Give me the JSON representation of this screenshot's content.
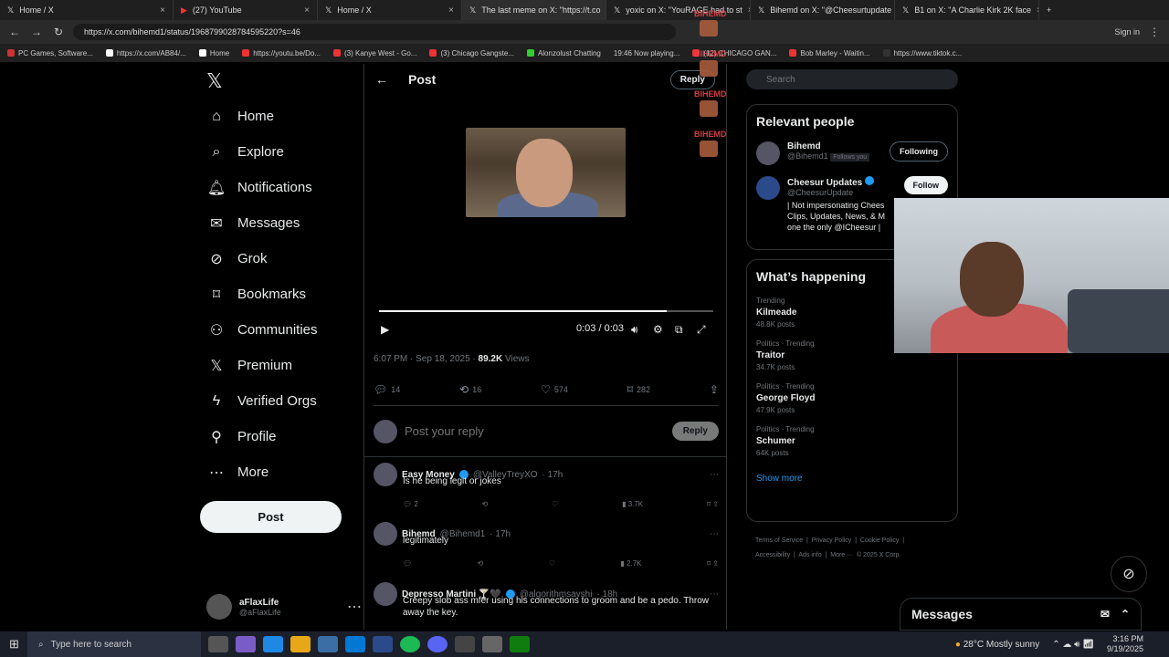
{
  "tabs": [
    {
      "label": "Home / X"
    },
    {
      "label": "(27) YouTube"
    },
    {
      "label": "Home / X"
    },
    {
      "label": "The last meme on X: \"https://t.co"
    },
    {
      "label": "yoxic on X: \"YouRAGE had to st"
    },
    {
      "label": "Bihemd on X: \"@Cheesurtupdate"
    },
    {
      "label": "B1 on X: \"A Charlie Kirk 2K face"
    }
  ],
  "address": {
    "url": "https://x.com/bihemd1/status/1968799028784595220?s=46",
    "signin": "Sign in"
  },
  "bookmarks": [
    {
      "label": "PC Games, Software..."
    },
    {
      "label": "https://x.com/AB84/..."
    },
    {
      "label": "Home"
    },
    {
      "label": "https://youtu.be/Do..."
    },
    {
      "label": "(3) Kanye West - Go..."
    },
    {
      "label": "(3) Chicago Gangste..."
    },
    {
      "label": "Alonzolust Chatting"
    },
    {
      "label": "19:46 Now playing..."
    },
    {
      "label": "(12) CHICAGO GAN..."
    },
    {
      "label": "Bob Marley - Waitin..."
    },
    {
      "label": "https://www.tiktok.c..."
    }
  ],
  "nav": {
    "items": [
      {
        "label": "Home",
        "icon": "home-icon"
      },
      {
        "label": "Explore",
        "icon": "search-icon"
      },
      {
        "label": "Notifications",
        "icon": "bell-icon"
      },
      {
        "label": "Messages",
        "icon": "mail-icon"
      },
      {
        "label": "Grok",
        "icon": "grok-icon"
      },
      {
        "label": "Bookmarks",
        "icon": "bookmark-icon"
      },
      {
        "label": "Communities",
        "icon": "people-icon"
      },
      {
        "label": "Premium",
        "icon": "x-icon"
      },
      {
        "label": "Verified Orgs",
        "icon": "bolt-icon"
      },
      {
        "label": "Profile",
        "icon": "person-icon"
      },
      {
        "label": "More",
        "icon": "more-icon"
      }
    ],
    "post_label": "Post",
    "account": {
      "name": "aFlaxLife",
      "handle": "@aFlaxLife"
    }
  },
  "main": {
    "title": "Post",
    "reply_label": "Reply",
    "video": {
      "time": "0:03 / 0:03",
      "progress": 0.86
    },
    "meta": {
      "time": "6:07 PM · Sep 18, 2025 · ",
      "views": "89.2K",
      "views_label": " Views"
    },
    "stats": {
      "replies": "14",
      "reposts": "16",
      "likes": "574",
      "bookmarks": "282"
    },
    "reply_placeholder": "Post your reply",
    "reply_button": "Reply",
    "replies": [
      {
        "name": "Easy Money",
        "handle": "@ValleyTreyXO",
        "time": "· 17h",
        "text": "Is he being legit or jokes",
        "replies": "2",
        "views": "3.7K"
      },
      {
        "name": "Bihemd",
        "handle": "@Bihemd1",
        "time": "· 17h",
        "text": "legitimately",
        "replies": "",
        "views": "2.7K"
      },
      {
        "name": "Depresso Martini 🍸🖤",
        "handle": "@algorithmsayshi",
        "time": "· 18h",
        "text": "Creepy slob ass mfer using his connections to groom and be a pedo. Throw away the key."
      }
    ]
  },
  "sidebar": {
    "search_placeholder": "Search",
    "relevant_title": "Relevant people",
    "people": [
      {
        "name": "Bihemd",
        "handle": "@Bihemd1",
        "follows_you": "Follows you",
        "button": "Following",
        "bio": ""
      },
      {
        "name": "Cheesur Updates",
        "handle": "@CheesurUpdate",
        "button": "Follow",
        "bio": "| Not impersonating Chees Clips, Updates, News, & M one the only @ICheesur |"
      }
    ],
    "happening_title": "What’s happening",
    "trends": [
      {
        "context": "Trending",
        "name": "Kilmeade",
        "count": "48.8K posts"
      },
      {
        "context": "Politics · Trending",
        "name": "Traitor",
        "count": "34.7K posts"
      },
      {
        "context": "Politics · Trending",
        "name": "George Floyd",
        "count": "47.9K posts"
      },
      {
        "context": "Politics · Trending",
        "name": "Schumer",
        "count": "64K posts"
      }
    ],
    "show_more": "Show more",
    "footer": [
      "Terms of Service",
      "Privacy Policy",
      "Cookie Policy",
      "Accessibility",
      "Ads info",
      "More ···",
      "© 2025 X Corp."
    ]
  },
  "overlay": {
    "chat_name": "BIHEMD",
    "messages_label": "Messages"
  },
  "taskbar": {
    "search_placeholder": "Type here to search",
    "weather": "28°C  Mostly sunny",
    "time": "3:16 PM",
    "date": "9/19/2025"
  },
  "colors": {
    "accent": "#1d9bf0",
    "background": "#000000",
    "muted": "#71767b"
  }
}
